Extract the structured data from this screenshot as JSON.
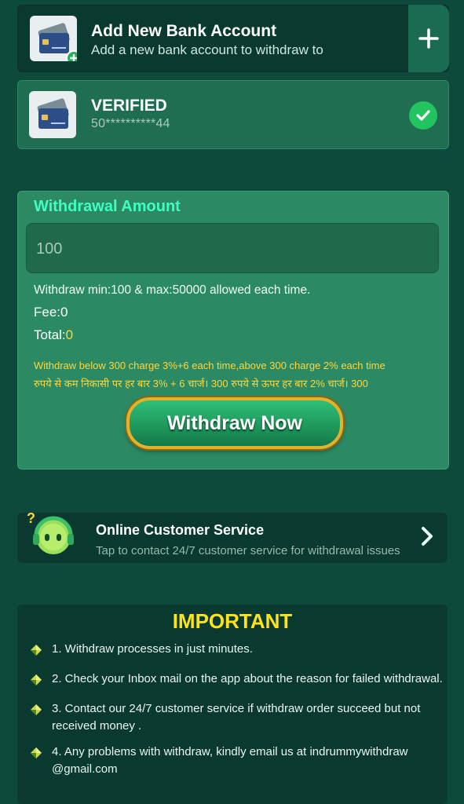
{
  "add_bank": {
    "title": "Add New Bank Account",
    "subtitle": "Add a new bank account to withdraw to",
    "button_icon": "plus-icon"
  },
  "verified": {
    "status": "VERIFIED",
    "account_masked": "50**********44",
    "icon": "check-icon"
  },
  "withdrawal": {
    "title": "Withdrawal Amount",
    "amount_placeholder": "100",
    "limit_text": "Withdraw min:100 & max:50000 allowed each time.",
    "fee_label": "Fee:0",
    "total_label": "Total:",
    "total_value": "0",
    "charge_en": "Withdraw below 300 charge 3%+6 each time,above 300 charge 2% each time",
    "charge_hi": "रुपये से कम निकासी पर हर बार 3% + 6 चार्ज। 300 रुपये से ऊपर हर बार 2% चार्ज। 300",
    "button_label": "Withdraw Now"
  },
  "customer_service": {
    "title": "Online Customer Service",
    "subtitle": "Tap to contact 24/7 customer service for withdrawal issues"
  },
  "important": {
    "title": "IMPORTANT",
    "items": [
      "1. Withdraw processes in just minutes.",
      "2. Check your Inbox mail on the app about the reason for failed withdrawal.",
      "3. Contact our 24/7 customer service if withdraw order succeed but not received money .",
      "4. Any problems with withdraw, kindly email us at indrummywithdraw @gmail.com"
    ]
  },
  "colors": {
    "background": "#0e4a3c",
    "accent_green": "#3dffc0",
    "highlight_yellow": "#ffd63b",
    "important_yellow": "#ffe31a"
  }
}
